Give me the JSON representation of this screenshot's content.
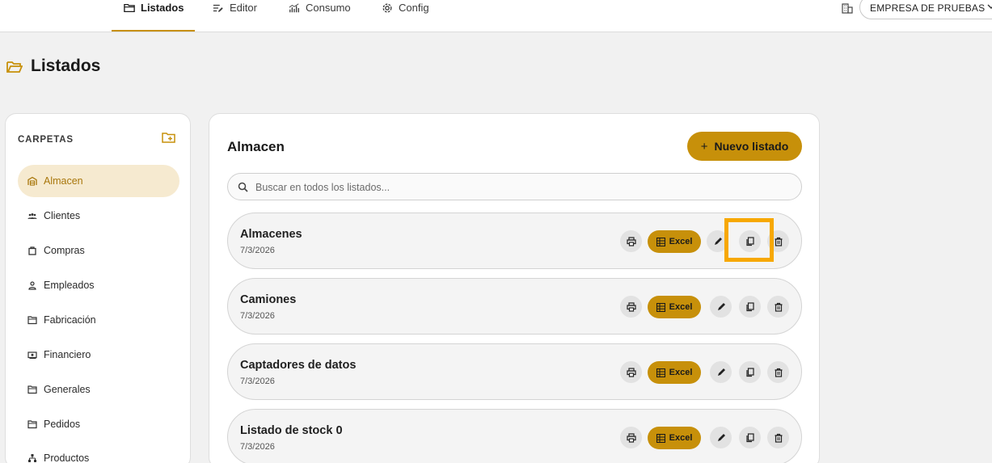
{
  "nav": {
    "tabs": [
      {
        "label": "Listados",
        "icon": "folder-icon",
        "active": true
      },
      {
        "label": "Editor",
        "icon": "edit-list-icon",
        "active": false
      },
      {
        "label": "Consumo",
        "icon": "chart-icon",
        "active": false
      },
      {
        "label": "Config",
        "icon": "gear-icon",
        "active": false
      }
    ],
    "company": "EMPRESA DE PRUEBAS"
  },
  "page": {
    "title": "Listados"
  },
  "sidebar": {
    "title": "CARPETAS",
    "items": [
      {
        "label": "Almacen",
        "icon": "warehouse-icon",
        "active": true
      },
      {
        "label": "Clientes",
        "icon": "people-icon"
      },
      {
        "label": "Compras",
        "icon": "bag-icon"
      },
      {
        "label": "Empleados",
        "icon": "person-icon"
      },
      {
        "label": "Fabricación",
        "icon": "folder-icon"
      },
      {
        "label": "Financiero",
        "icon": "money-icon"
      },
      {
        "label": "Generales",
        "icon": "folder-icon"
      },
      {
        "label": "Pedidos",
        "icon": "folder-icon"
      },
      {
        "label": "Productos",
        "icon": "tree-icon"
      }
    ]
  },
  "main": {
    "title": "Almacen",
    "new_button": "Nuevo listado",
    "search_placeholder": "Buscar en todos los listados...",
    "excel_label": "Excel",
    "listados": [
      {
        "name": "Almacenes",
        "date": "7/3/2026"
      },
      {
        "name": "Camiones",
        "date": "7/3/2026"
      },
      {
        "name": "Captadores de datos",
        "date": "7/3/2026"
      },
      {
        "name": "Listado de stock 0",
        "date": "7/3/2026"
      }
    ]
  },
  "colors": {
    "accent": "#c7900a",
    "highlight": "#f7a800",
    "active_bg": "#f6ead0"
  }
}
